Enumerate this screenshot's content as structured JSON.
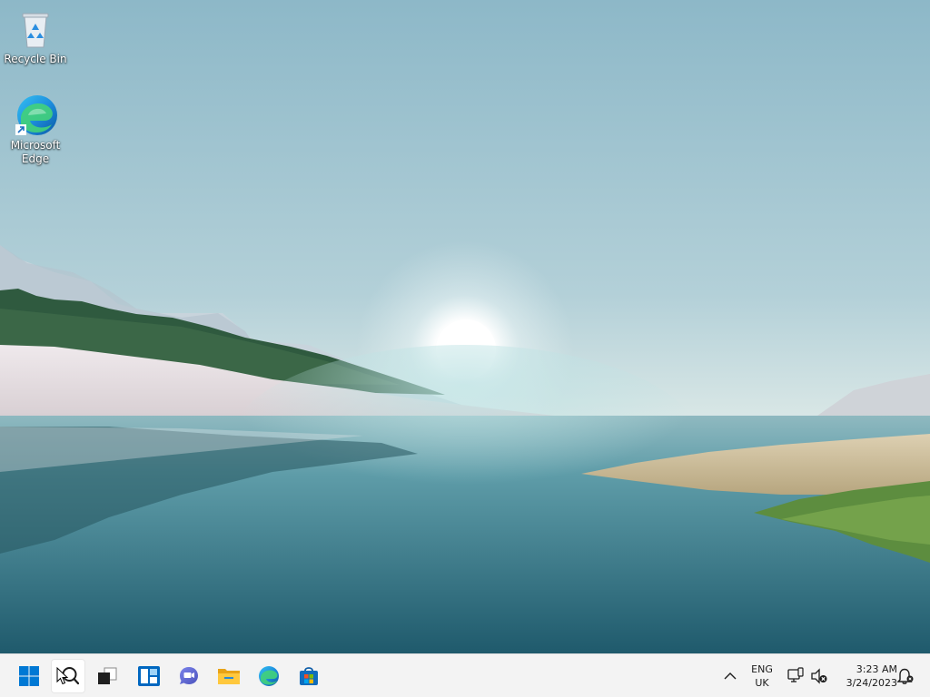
{
  "desktop": {
    "icons": [
      {
        "label": "Recycle Bin",
        "icon": "recycle-bin-icon"
      },
      {
        "label": "Microsoft\nEdge",
        "icon": "edge-icon"
      }
    ]
  },
  "taskbar": {
    "apps": [
      {
        "name": "Start",
        "icon": "windows-logo-icon"
      },
      {
        "name": "Search",
        "icon": "search-icon"
      },
      {
        "name": "Task View",
        "icon": "task-view-icon"
      },
      {
        "name": "Widgets",
        "icon": "widgets-icon"
      },
      {
        "name": "Chat",
        "icon": "chat-icon"
      },
      {
        "name": "File Explorer",
        "icon": "folder-icon"
      },
      {
        "name": "Microsoft Edge",
        "icon": "edge-icon"
      },
      {
        "name": "Microsoft Store",
        "icon": "store-icon"
      }
    ],
    "tray": {
      "lang_line1": "ENG",
      "lang_line2": "UK",
      "time": "3:23 AM",
      "date": "3/24/2023"
    }
  },
  "colors": {
    "accent": "#0067c0",
    "taskbar_bg": "#f3f3f3",
    "sky_top": "#8fb9c9",
    "water": "#3f8796"
  }
}
